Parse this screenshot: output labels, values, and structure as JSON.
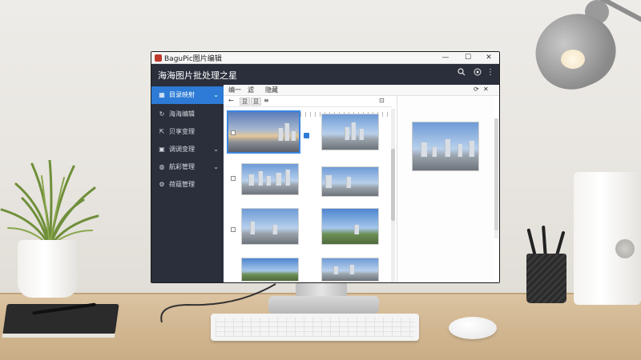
{
  "window": {
    "title": "BaguPic图片编辑",
    "minimize": "—",
    "maximize": "☐",
    "close": "✕"
  },
  "header": {
    "app_title": "海海图片批处理之星",
    "search_icon": "search-icon",
    "camera_icon": "camera-icon",
    "more_icon": "more-vertical-icon"
  },
  "sidebar": {
    "items": [
      {
        "label": "目录映射",
        "icon": "grid-icon",
        "chevron": "⌄",
        "active": true
      },
      {
        "label": "海海编辑",
        "icon": "refresh-icon",
        "chevron": "",
        "active": false
      },
      {
        "label": "贝享变理",
        "icon": "share-icon",
        "chevron": "",
        "active": false
      },
      {
        "label": "调调变理",
        "icon": "book-icon",
        "chevron": "⌄",
        "active": false
      },
      {
        "label": "航彩管理",
        "icon": "palette-icon",
        "chevron": "⌄",
        "active": false
      },
      {
        "label": "荷蕴管理",
        "icon": "gear-icon",
        "chevron": "",
        "active": false
      }
    ]
  },
  "main": {
    "tabs": [
      "编一",
      "滤",
      "隐藏"
    ],
    "toolbar": {
      "back": "←",
      "btn1": "显",
      "btn2": "显",
      "item3": "≡",
      "item4": "⊡"
    },
    "rows": 4
  },
  "colors": {
    "sidebar_bg": "#2a2f3b",
    "accent": "#2d7bd6",
    "desk": "#d3b994",
    "wall": "#eeece8"
  }
}
